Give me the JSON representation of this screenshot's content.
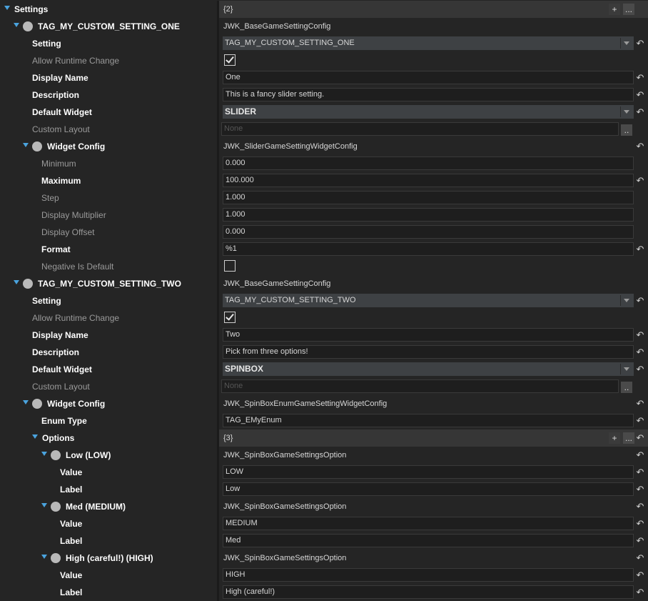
{
  "rows": [
    {
      "type": "header",
      "depth": 0,
      "arrow": true,
      "circle": false,
      "label": "Settings",
      "style": "bold",
      "value": "{2}",
      "plus": "+",
      "more": "..."
    },
    {
      "type": "plain",
      "depth": 1,
      "arrow": true,
      "circle": true,
      "label": "TAG_MY_CUSTOM_SETTING_ONE",
      "style": "bold",
      "value": "JWK_BaseGameSettingConfig",
      "reset": false
    },
    {
      "type": "dropdown",
      "depth": 2,
      "label": "Setting",
      "style": "bold",
      "value": "TAG_MY_CUSTOM_SETTING_ONE",
      "reset": true
    },
    {
      "type": "checkbox",
      "depth": 2,
      "label": "Allow Runtime Change",
      "style": "dim",
      "checked": true
    },
    {
      "type": "text",
      "depth": 2,
      "label": "Display Name",
      "style": "bold",
      "value": "One",
      "reset": true
    },
    {
      "type": "text",
      "depth": 2,
      "label": "Description",
      "style": "bold",
      "value": "This is a fancy slider setting.",
      "reset": true
    },
    {
      "type": "dropdown",
      "depth": 2,
      "label": "Default Widget",
      "style": "bold",
      "value": "SLIDER",
      "big": true,
      "reset": true
    },
    {
      "type": "picker",
      "depth": 2,
      "label": "Custom Layout",
      "style": "dim",
      "value": "None",
      "button": ".."
    },
    {
      "type": "plain",
      "depth": 2,
      "arrow": true,
      "circle": true,
      "label": "Widget Config",
      "style": "bold",
      "value": "JWK_SliderGameSettingWidgetConfig",
      "reset": true
    },
    {
      "type": "text",
      "depth": 3,
      "label": "Minimum",
      "style": "dim",
      "value": "0.000",
      "reset": false
    },
    {
      "type": "text",
      "depth": 3,
      "label": "Maximum",
      "style": "bold",
      "value": "100.000",
      "reset": true
    },
    {
      "type": "text",
      "depth": 3,
      "label": "Step",
      "style": "dim",
      "value": "1.000",
      "reset": false
    },
    {
      "type": "text",
      "depth": 3,
      "label": "Display Multiplier",
      "style": "dim",
      "value": "1.000",
      "reset": false
    },
    {
      "type": "text",
      "depth": 3,
      "label": "Display Offset",
      "style": "dim",
      "value": "0.000",
      "reset": false
    },
    {
      "type": "text",
      "depth": 3,
      "label": "Format",
      "style": "bold",
      "value": "%1",
      "reset": true
    },
    {
      "type": "checkbox",
      "depth": 3,
      "label": "Negative Is Default",
      "style": "dim",
      "checked": false
    },
    {
      "type": "plain",
      "depth": 1,
      "arrow": true,
      "circle": true,
      "label": "TAG_MY_CUSTOM_SETTING_TWO",
      "style": "bold",
      "value": "JWK_BaseGameSettingConfig",
      "reset": false
    },
    {
      "type": "dropdown",
      "depth": 2,
      "label": "Setting",
      "style": "bold",
      "value": "TAG_MY_CUSTOM_SETTING_TWO",
      "reset": true
    },
    {
      "type": "checkbox",
      "depth": 2,
      "label": "Allow Runtime Change",
      "style": "dim",
      "checked": true
    },
    {
      "type": "text",
      "depth": 2,
      "label": "Display Name",
      "style": "bold",
      "value": "Two",
      "reset": true
    },
    {
      "type": "text",
      "depth": 2,
      "label": "Description",
      "style": "bold",
      "value": "Pick from three options!",
      "reset": true
    },
    {
      "type": "dropdown",
      "depth": 2,
      "label": "Default Widget",
      "style": "bold",
      "value": "SPINBOX",
      "big": true,
      "reset": true
    },
    {
      "type": "picker",
      "depth": 2,
      "label": "Custom Layout",
      "style": "dim",
      "value": "None",
      "button": ".."
    },
    {
      "type": "plain",
      "depth": 2,
      "arrow": true,
      "circle": true,
      "label": "Widget Config",
      "style": "bold",
      "value": "JWK_SpinBoxEnumGameSettingWidgetConfig",
      "reset": true
    },
    {
      "type": "text",
      "depth": 3,
      "label": "Enum Type",
      "style": "bold",
      "value": "TAG_EMyEnum",
      "reset": true
    },
    {
      "type": "header",
      "depth": 3,
      "arrow": true,
      "circle": false,
      "label": "Options",
      "style": "bold",
      "value": "{3}",
      "plus": "+",
      "more": "...",
      "reset": true
    },
    {
      "type": "plain",
      "depth": 4,
      "arrow": true,
      "circle": true,
      "label": "Low (LOW)",
      "style": "bold",
      "value": "JWK_SpinBoxGameSettingsOption",
      "reset": true
    },
    {
      "type": "text",
      "depth": 5,
      "label": "Value",
      "style": "bold",
      "value": "LOW",
      "reset": true
    },
    {
      "type": "text",
      "depth": 5,
      "label": "Label",
      "style": "bold",
      "value": "Low",
      "reset": true
    },
    {
      "type": "plain",
      "depth": 4,
      "arrow": true,
      "circle": true,
      "label": "Med (MEDIUM)",
      "style": "bold",
      "value": "JWK_SpinBoxGameSettingsOption",
      "reset": true
    },
    {
      "type": "text",
      "depth": 5,
      "label": "Value",
      "style": "bold",
      "value": "MEDIUM",
      "reset": true
    },
    {
      "type": "text",
      "depth": 5,
      "label": "Label",
      "style": "bold",
      "value": "Med",
      "reset": true
    },
    {
      "type": "plain",
      "depth": 4,
      "arrow": true,
      "circle": true,
      "label": "High (careful!) (HIGH)",
      "style": "bold",
      "value": "JWK_SpinBoxGameSettingsOption",
      "reset": true
    },
    {
      "type": "text",
      "depth": 5,
      "label": "Value",
      "style": "bold",
      "value": "HIGH",
      "reset": true
    },
    {
      "type": "text",
      "depth": 5,
      "label": "Label",
      "style": "bold",
      "value": "High (careful!)",
      "reset": true
    }
  ],
  "icons": {
    "expand": "chevron-down-icon",
    "node": "object-circle-icon",
    "reset": "reset-arrow-icon",
    "add": "plus-icon",
    "more": "ellipsis-icon",
    "dropdown": "dropdown-arrow-icon",
    "check": "checkmark-icon"
  },
  "colors": {
    "background": "#252525",
    "accent_arrow": "#4aa3de",
    "field": "#1e1e1e",
    "dropdown": "#3e4144",
    "header": "#363636"
  }
}
